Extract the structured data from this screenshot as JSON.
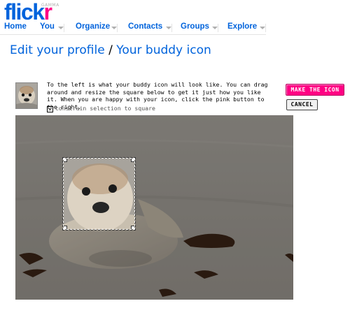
{
  "logo": {
    "main": "flick",
    "accent": "r",
    "badge": "GAMMA"
  },
  "nav": [
    {
      "label": "Home"
    },
    {
      "label": "You"
    },
    {
      "label": "Organize"
    },
    {
      "label": "Contacts"
    },
    {
      "label": "Groups"
    },
    {
      "label": "Explore"
    }
  ],
  "title": {
    "part1": "Edit your profile",
    "separator": "/",
    "part2": "Your buddy icon"
  },
  "instructions": "To the left is what your buddy icon will look like. You can drag around and resize the square below to get it just how you like it. When you are happy with your icon, click the pink button to the right.",
  "constrain": {
    "label": "constrain selection to square",
    "checked": true
  },
  "buttons": {
    "make": "MAKE THE ICON",
    "cancel": "CANCEL"
  },
  "colors": {
    "brand_blue": "#0063dc",
    "brand_pink": "#ff0084"
  },
  "icons": {
    "nav_dropdown": "chevron-down-icon",
    "checkbox": "checkbox-checked-icon"
  }
}
